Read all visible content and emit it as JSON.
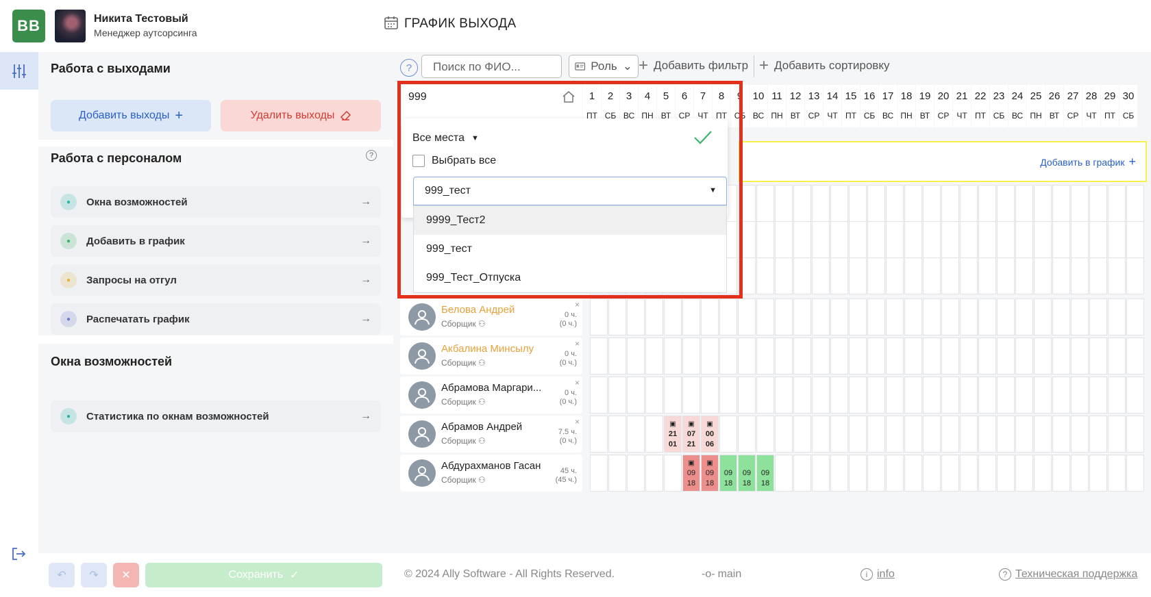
{
  "app": {
    "logo_text": "BB",
    "user_name": "Никита Тестовый",
    "user_role": "Менеджер аутсорсинга",
    "page_title": "ГРАФИК ВЫХОДА"
  },
  "panel": {
    "work_title": "Работа с выходами",
    "add_shifts": "Добавить выходы",
    "del_shifts": "Удалить выходы",
    "staff_title": "Работа с персоналом",
    "staff_items": [
      {
        "label": "Окна возможностей",
        "icon": "lifebuoy-icon",
        "color": "#2bb3a8"
      },
      {
        "label": "Добавить в график",
        "icon": "user-icon",
        "color": "#3bb56a"
      },
      {
        "label": "Запросы на отгул",
        "icon": "plus-icon",
        "color": "#e4b23a"
      },
      {
        "label": "Распечатать график",
        "icon": "printer-icon",
        "color": "#6f78c8"
      }
    ],
    "windows_title": "Окна возможностей",
    "windows_items": [
      {
        "label": "Статистика по окнам возможностей",
        "icon": "stats-icon",
        "color": "#2bb3a8"
      }
    ],
    "save_label": "Сохранить"
  },
  "toolbar": {
    "search_placeholder": "Поиск по ФИО...",
    "role_label": "Роль",
    "add_filter": "Добавить фильтр",
    "add_sort": "Добавить сортировку"
  },
  "filter": {
    "location_value": "999",
    "places_label": "Все места",
    "select_all": "Выбрать все",
    "combo_value": "999_тест",
    "options": [
      "9999_Тест2",
      "999_тест",
      "999_Тест_Отпуска"
    ]
  },
  "days": [
    {
      "n": "1",
      "w": "ПТ"
    },
    {
      "n": "2",
      "w": "СБ"
    },
    {
      "n": "3",
      "w": "ВС"
    },
    {
      "n": "4",
      "w": "ПН"
    },
    {
      "n": "5",
      "w": "ВТ"
    },
    {
      "n": "6",
      "w": "СР"
    },
    {
      "n": "7",
      "w": "ЧТ"
    },
    {
      "n": "8",
      "w": "ПТ"
    },
    {
      "n": "9",
      "w": "СБ"
    },
    {
      "n": "10",
      "w": "ВС"
    },
    {
      "n": "11",
      "w": "ПН"
    },
    {
      "n": "12",
      "w": "ВТ"
    },
    {
      "n": "13",
      "w": "СР"
    },
    {
      "n": "14",
      "w": "ЧТ"
    },
    {
      "n": "15",
      "w": "ПТ"
    },
    {
      "n": "16",
      "w": "СБ"
    },
    {
      "n": "17",
      "w": "ВС"
    },
    {
      "n": "18",
      "w": "ПН"
    },
    {
      "n": "19",
      "w": "ВТ"
    },
    {
      "n": "20",
      "w": "СР"
    },
    {
      "n": "21",
      "w": "ЧТ"
    },
    {
      "n": "22",
      "w": "ПТ"
    },
    {
      "n": "23",
      "w": "СБ"
    },
    {
      "n": "24",
      "w": "ВС"
    },
    {
      "n": "25",
      "w": "ПН"
    },
    {
      "n": "26",
      "w": "ВТ"
    },
    {
      "n": "27",
      "w": "СР"
    },
    {
      "n": "28",
      "w": "ЧТ"
    },
    {
      "n": "29",
      "w": "ПТ"
    },
    {
      "n": "30",
      "w": "СБ"
    }
  ],
  "add_to_schedule": "Добавить в график",
  "employees": [
    {
      "name": "Белова Андрей",
      "role": "Сборщик",
      "hours": "0 ч.",
      "hours2": "(0 ч.)",
      "highlight": true,
      "shifts": []
    },
    {
      "name": "Акбалина Минсылу",
      "role": "Сборщик",
      "hours": "0 ч.",
      "hours2": "(0 ч.)",
      "highlight": true,
      "shifts": []
    },
    {
      "name": "Абрамова Маргари...",
      "role": "Сборщик",
      "hours": "0 ч.",
      "hours2": "(0 ч.)",
      "highlight": false,
      "shifts": []
    },
    {
      "name": "Абрамов Андрей",
      "role": "Сборщик",
      "hours": "7.5 ч.",
      "hours2": "(0 ч.)",
      "highlight": false,
      "shifts": [
        {
          "day": 5,
          "a": "21",
          "b": "01",
          "type": "pink-icon"
        },
        {
          "day": 6,
          "a": "07",
          "b": "21",
          "type": "pink-icon"
        },
        {
          "day": 7,
          "a": "00",
          "b": "06",
          "type": "pink-icon"
        }
      ]
    },
    {
      "name": "Абдурахманов Гасан",
      "role": "Сборщик",
      "hours": "45 ч.",
      "hours2": "(45 ч.)",
      "highlight": false,
      "shifts": [
        {
          "day": 6,
          "a": "09",
          "b": "18",
          "type": "red-icon"
        },
        {
          "day": 7,
          "a": "09",
          "b": "18",
          "type": "red-icon"
        },
        {
          "day": 8,
          "a": "09",
          "b": "18",
          "type": "green"
        },
        {
          "day": 9,
          "a": "09",
          "b": "18",
          "type": "green"
        },
        {
          "day": 10,
          "a": "09",
          "b": "18",
          "type": "green"
        }
      ]
    }
  ],
  "footer": {
    "copyright": "© 2024 Ally Software - All Rights Reserved.",
    "branch": "main",
    "info": "info",
    "support": "Техническая поддержка"
  }
}
